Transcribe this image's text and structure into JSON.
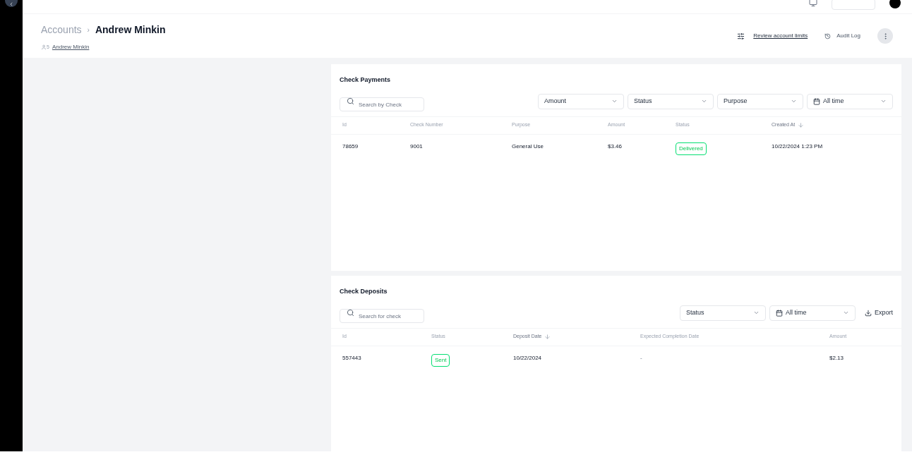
{
  "breadcrumb": {
    "parent": "Accounts",
    "separator": "›",
    "current": "Andrew Minkin"
  },
  "customer_link": {
    "count": "5",
    "name": "Andrew Minkin"
  },
  "actions": {
    "limits": "Review account limits",
    "audit": "Audit Log"
  },
  "check_payments": {
    "title": "Check Payments",
    "search": {
      "placeholder": "Search by Check"
    },
    "filters": [
      {
        "label": "Amount",
        "kind": "select"
      },
      {
        "label": "Status",
        "kind": "select"
      },
      {
        "label": "Purpose",
        "kind": "select"
      },
      {
        "label": "All time",
        "kind": "date"
      }
    ],
    "columns": [
      {
        "label": "Id",
        "sorted": false
      },
      {
        "label": "Check Number",
        "sorted": false
      },
      {
        "label": "Purpose",
        "sorted": false
      },
      {
        "label": "Amount",
        "sorted": false
      },
      {
        "label": "Status",
        "sorted": false
      },
      {
        "label": "Created At",
        "sorted": true
      }
    ],
    "rows": [
      {
        "cells": [
          "78659",
          "9001",
          "General Use",
          "$3.46",
          "Delivered",
          "10/22/2024 1:23 PM"
        ]
      }
    ]
  },
  "check_deposits": {
    "title": "Check Deposits",
    "search": {
      "placeholder": "Search for check"
    },
    "filters": [
      {
        "label": "Status",
        "kind": "select"
      },
      {
        "label": "All time",
        "kind": "date"
      }
    ],
    "export": "Export",
    "columns": [
      {
        "label": "Id",
        "sorted": false
      },
      {
        "label": "Status",
        "sorted": false
      },
      {
        "label": "Deposit Date",
        "sorted": true
      },
      {
        "label": "Expected Completion Date",
        "sorted": false
      },
      {
        "label": "Amount",
        "sorted": false
      }
    ],
    "rows": [
      {
        "cells": [
          "557443",
          "Sent",
          "10/22/2024",
          "-",
          "$2.13"
        ]
      }
    ]
  }
}
